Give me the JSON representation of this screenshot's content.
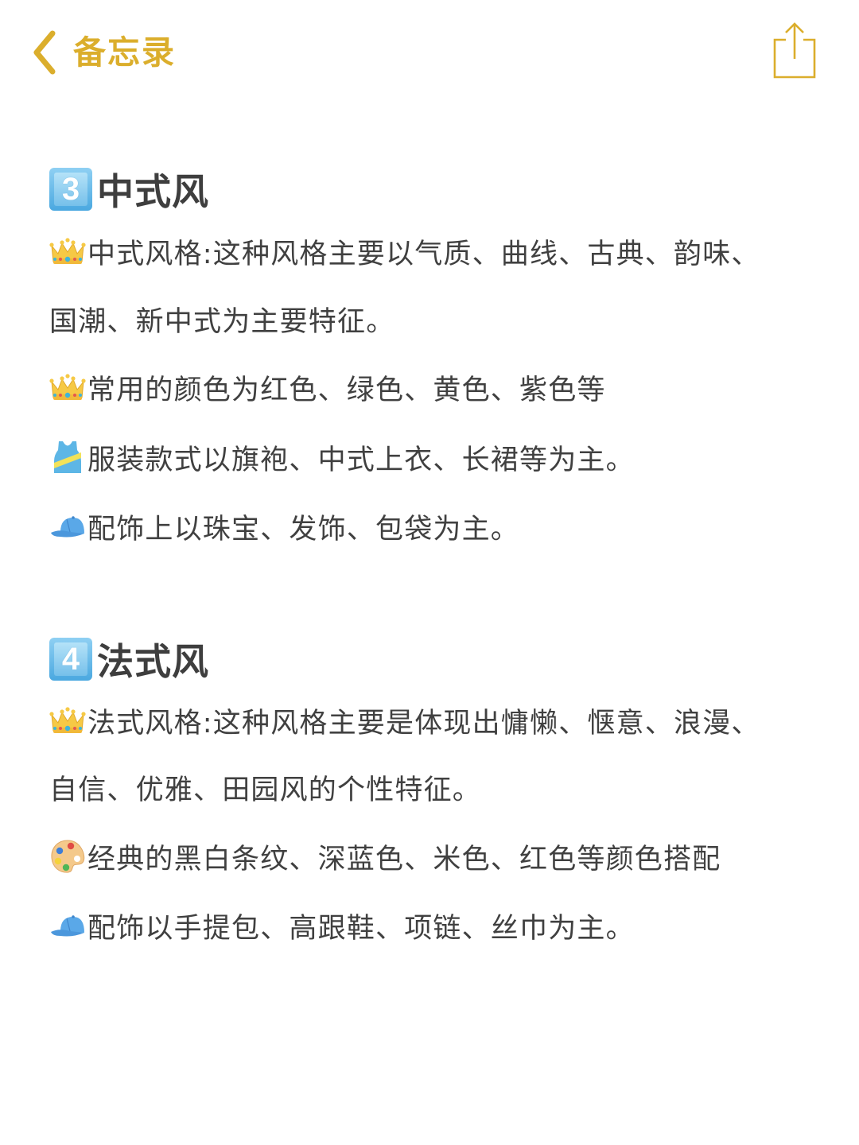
{
  "navbar": {
    "back_label": "备忘录",
    "back_icon": "chevron-left-icon",
    "share_icon": "share-icon",
    "accent_color": "#dbae2c"
  },
  "sections": [
    {
      "number": "3",
      "badge_icon": "keycap-3-icon",
      "title": "中式风",
      "lines": [
        {
          "icon": "crown-icon",
          "text": "中式风格:这种风格主要以气质、曲线、古典、韵味、"
        },
        {
          "icon": "",
          "text": "国潮、新中式为主要特征。"
        },
        {
          "icon": "crown-icon",
          "text": "常用的颜色为红色、绿色、黄色、紫色等"
        },
        {
          "icon": "tank-top-icon",
          "text": "服装款式以旗袍、中式上衣、长裙等为主。"
        },
        {
          "icon": "cap-icon",
          "text": "配饰上以珠宝、发饰、包袋为主。"
        }
      ]
    },
    {
      "number": "4",
      "badge_icon": "keycap-4-icon",
      "title": "法式风",
      "lines": [
        {
          "icon": "crown-icon",
          "text": "法式风格:这种风格主要是体现出慵懒、惬意、浪漫、"
        },
        {
          "icon": "",
          "text": "自信、优雅、田园风的个性特征。"
        },
        {
          "icon": "palette-icon",
          "text": "经典的黑白条纹、深蓝色、米色、红色等颜色搭配"
        },
        {
          "icon": "cap-icon",
          "text": "配饰以手提包、高跟鞋、项链、丝巾为主。"
        }
      ]
    }
  ]
}
